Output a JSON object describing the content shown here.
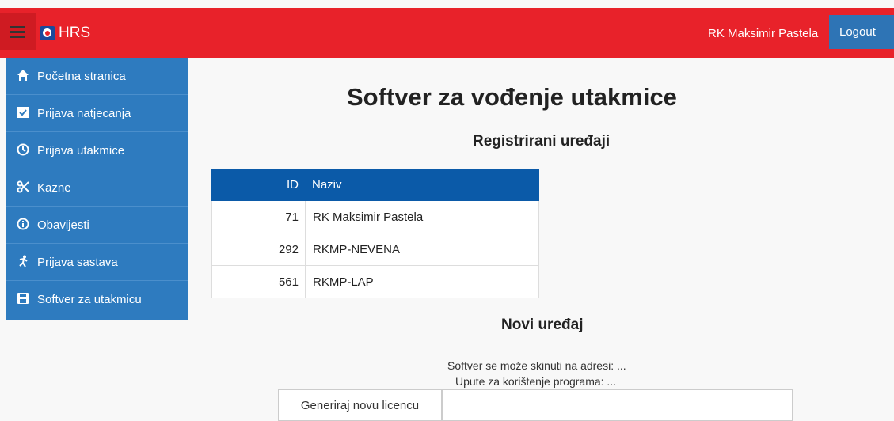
{
  "header": {
    "brand": "HRS",
    "user": "RK Maksimir Pastela",
    "logout_label": "Logout"
  },
  "sidebar": {
    "items": [
      {
        "label": "Početna stranica",
        "icon": "home-icon"
      },
      {
        "label": "Prijava natjecanja",
        "icon": "checkbox-icon"
      },
      {
        "label": "Prijava utakmice",
        "icon": "clock-icon"
      },
      {
        "label": "Kazne",
        "icon": "scissors-icon"
      },
      {
        "label": "Obavijesti",
        "icon": "info-icon"
      },
      {
        "label": "Prijava sastava",
        "icon": "runner-icon"
      },
      {
        "label": "Softver za utakmicu",
        "icon": "save-icon"
      }
    ]
  },
  "main": {
    "title": "Softver za vođenje utakmice",
    "subtitle": "Registrirani uređaji",
    "table": {
      "headers": [
        "ID",
        "Naziv"
      ],
      "rows": [
        {
          "id": "71",
          "naziv": "RK Maksimir Pastela"
        },
        {
          "id": "292",
          "naziv": "RKMP-NEVENA"
        },
        {
          "id": "561",
          "naziv": "RKMP-LAP"
        }
      ]
    },
    "new_device": {
      "title": "Novi uređaj",
      "info1": "Softver se može skinuti na adresi: ...",
      "info2": "Upute za korištenje programa: ...",
      "generate_label": "Generiraj novu licencu",
      "license_value": ""
    }
  },
  "colors": {
    "navbar": "#e8222a",
    "sidebar": "#2e7bbf",
    "table_header": "#0b5aa8",
    "logout": "#2e74b5"
  }
}
